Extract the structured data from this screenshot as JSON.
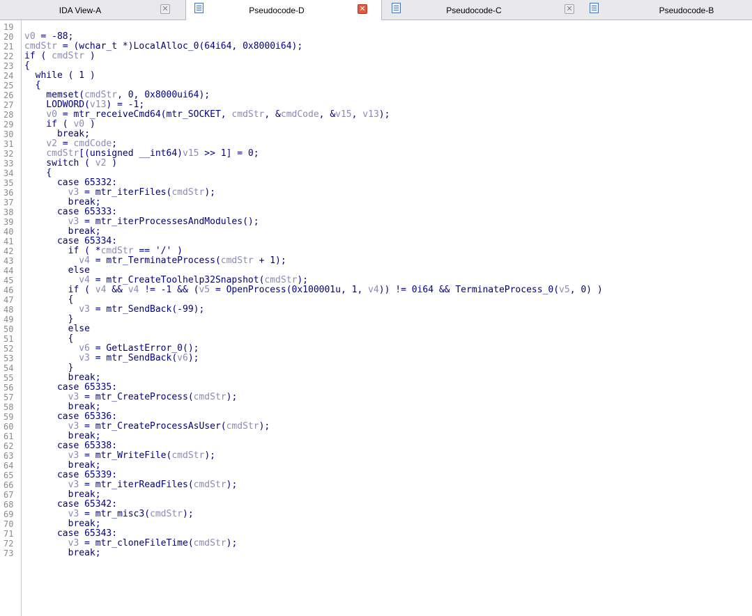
{
  "tabs": [
    {
      "label": "IDA View-A",
      "active": false,
      "icon": "none"
    },
    {
      "label": "Pseudocode-D",
      "active": true,
      "icon": "pseudocode-icon"
    },
    {
      "label": "Pseudocode-C",
      "active": false,
      "icon": "pseudocode-icon"
    },
    {
      "label": "Pseudocode-B",
      "active": false,
      "icon": "pseudocode-icon"
    }
  ],
  "close_glyph": "✕",
  "colors": {
    "code": "#000080",
    "variable": "#8a8ab8",
    "line_number": "#8a8a8a",
    "active_close": "#e2593e"
  },
  "code": {
    "first_line": 19,
    "lines": [
      [],
      [
        [
          "v",
          "v0"
        ],
        [
          "t",
          " = -88;"
        ]
      ],
      [
        [
          "v",
          "cmdStr"
        ],
        [
          "t",
          " = (wchar_t *)LocalAlloc_0(64i64, 0x8000i64);"
        ]
      ],
      [
        [
          "t",
          "if ( "
        ],
        [
          "v",
          "cmdStr"
        ],
        [
          "t",
          " )"
        ]
      ],
      [
        [
          "t",
          "{"
        ]
      ],
      [
        [
          "t",
          "  while ( 1 )"
        ]
      ],
      [
        [
          "t",
          "  {"
        ]
      ],
      [
        [
          "t",
          "    memset("
        ],
        [
          "v",
          "cmdStr"
        ],
        [
          "t",
          ", 0, 0x8000ui64);"
        ]
      ],
      [
        [
          "t",
          "    LODWORD("
        ],
        [
          "v",
          "v13"
        ],
        [
          "t",
          ") = -1;"
        ]
      ],
      [
        [
          "t",
          "    "
        ],
        [
          "v",
          "v0"
        ],
        [
          "t",
          " = mtr_receiveCmd64(mtr_SOCKET, "
        ],
        [
          "v",
          "cmdStr"
        ],
        [
          "t",
          ", &"
        ],
        [
          "v",
          "cmdCode"
        ],
        [
          "t",
          ", &"
        ],
        [
          "v",
          "v15"
        ],
        [
          "t",
          ", "
        ],
        [
          "v",
          "v13"
        ],
        [
          "t",
          ");"
        ]
      ],
      [
        [
          "t",
          "    if ( "
        ],
        [
          "v",
          "v0"
        ],
        [
          "t",
          " )"
        ]
      ],
      [
        [
          "t",
          "      break;"
        ]
      ],
      [
        [
          "t",
          "    "
        ],
        [
          "v",
          "v2"
        ],
        [
          "t",
          " = "
        ],
        [
          "v",
          "cmdCode"
        ],
        [
          "t",
          ";"
        ]
      ],
      [
        [
          "t",
          "    "
        ],
        [
          "v",
          "cmdStr"
        ],
        [
          "t",
          "[(unsigned __int64)"
        ],
        [
          "v",
          "v15"
        ],
        [
          "t",
          " >> 1] = 0;"
        ]
      ],
      [
        [
          "t",
          "    switch ( "
        ],
        [
          "v",
          "v2"
        ],
        [
          "t",
          " )"
        ]
      ],
      [
        [
          "t",
          "    {"
        ]
      ],
      [
        [
          "t",
          "      case 65332:"
        ]
      ],
      [
        [
          "t",
          "        "
        ],
        [
          "v",
          "v3"
        ],
        [
          "t",
          " = mtr_iterFiles("
        ],
        [
          "v",
          "cmdStr"
        ],
        [
          "t",
          ");"
        ]
      ],
      [
        [
          "t",
          "        break;"
        ]
      ],
      [
        [
          "t",
          "      case 65333:"
        ]
      ],
      [
        [
          "t",
          "        "
        ],
        [
          "v",
          "v3"
        ],
        [
          "t",
          " = mtr_iterProcessesAndModules();"
        ]
      ],
      [
        [
          "t",
          "        break;"
        ]
      ],
      [
        [
          "t",
          "      case 65334:"
        ]
      ],
      [
        [
          "t",
          "        if ( *"
        ],
        [
          "v",
          "cmdStr"
        ],
        [
          "t",
          " == '/' )"
        ]
      ],
      [
        [
          "t",
          "          "
        ],
        [
          "v",
          "v4"
        ],
        [
          "t",
          " = mtr_TerminateProcess("
        ],
        [
          "v",
          "cmdStr"
        ],
        [
          "t",
          " + 1);"
        ]
      ],
      [
        [
          "t",
          "        else"
        ]
      ],
      [
        [
          "t",
          "          "
        ],
        [
          "v",
          "v4"
        ],
        [
          "t",
          " = mtr_CreateToolhelp32Snapshot("
        ],
        [
          "v",
          "cmdStr"
        ],
        [
          "t",
          ");"
        ]
      ],
      [
        [
          "t",
          "        if ( "
        ],
        [
          "v",
          "v4"
        ],
        [
          "t",
          " && "
        ],
        [
          "v",
          "v4"
        ],
        [
          "t",
          " != -1 && ("
        ],
        [
          "v",
          "v5"
        ],
        [
          "t",
          " = OpenProcess(0x100001u, 1, "
        ],
        [
          "v",
          "v4"
        ],
        [
          "t",
          ")) != 0i64 && TerminateProcess_0("
        ],
        [
          "v",
          "v5"
        ],
        [
          "t",
          ", 0) )"
        ]
      ],
      [
        [
          "t",
          "        {"
        ]
      ],
      [
        [
          "t",
          "          "
        ],
        [
          "v",
          "v3"
        ],
        [
          "t",
          " = mtr_SendBack(-99);"
        ]
      ],
      [
        [
          "t",
          "        }"
        ]
      ],
      [
        [
          "t",
          "        else"
        ]
      ],
      [
        [
          "t",
          "        {"
        ]
      ],
      [
        [
          "t",
          "          "
        ],
        [
          "v",
          "v6"
        ],
        [
          "t",
          " = GetLastError_0();"
        ]
      ],
      [
        [
          "t",
          "          "
        ],
        [
          "v",
          "v3"
        ],
        [
          "t",
          " = mtr_SendBack("
        ],
        [
          "v",
          "v6"
        ],
        [
          "t",
          ");"
        ]
      ],
      [
        [
          "t",
          "        }"
        ]
      ],
      [
        [
          "t",
          "        break;"
        ]
      ],
      [
        [
          "t",
          "      case 65335:"
        ]
      ],
      [
        [
          "t",
          "        "
        ],
        [
          "v",
          "v3"
        ],
        [
          "t",
          " = mtr_CreateProcess("
        ],
        [
          "v",
          "cmdStr"
        ],
        [
          "t",
          ");"
        ]
      ],
      [
        [
          "t",
          "        break;"
        ]
      ],
      [
        [
          "t",
          "      case 65336:"
        ]
      ],
      [
        [
          "t",
          "        "
        ],
        [
          "v",
          "v3"
        ],
        [
          "t",
          " = mtr_CreateProcessAsUser("
        ],
        [
          "v",
          "cmdStr"
        ],
        [
          "t",
          ");"
        ]
      ],
      [
        [
          "t",
          "        break;"
        ]
      ],
      [
        [
          "t",
          "      case 65338:"
        ]
      ],
      [
        [
          "t",
          "        "
        ],
        [
          "v",
          "v3"
        ],
        [
          "t",
          " = mtr_WriteFile("
        ],
        [
          "v",
          "cmdStr"
        ],
        [
          "t",
          ");"
        ]
      ],
      [
        [
          "t",
          "        break;"
        ]
      ],
      [
        [
          "t",
          "      case 65339:"
        ]
      ],
      [
        [
          "t",
          "        "
        ],
        [
          "v",
          "v3"
        ],
        [
          "t",
          " = mtr_iterReadFiles("
        ],
        [
          "v",
          "cmdStr"
        ],
        [
          "t",
          ");"
        ]
      ],
      [
        [
          "t",
          "        break;"
        ]
      ],
      [
        [
          "t",
          "      case 65342:"
        ]
      ],
      [
        [
          "t",
          "        "
        ],
        [
          "v",
          "v3"
        ],
        [
          "t",
          " = mtr_misc3("
        ],
        [
          "v",
          "cmdStr"
        ],
        [
          "t",
          ");"
        ]
      ],
      [
        [
          "t",
          "        break;"
        ]
      ],
      [
        [
          "t",
          "      case 65343:"
        ]
      ],
      [
        [
          "t",
          "        "
        ],
        [
          "v",
          "v3"
        ],
        [
          "t",
          " = mtr_cloneFileTime("
        ],
        [
          "v",
          "cmdStr"
        ],
        [
          "t",
          ");"
        ]
      ],
      [
        [
          "t",
          "        break;"
        ]
      ]
    ]
  }
}
